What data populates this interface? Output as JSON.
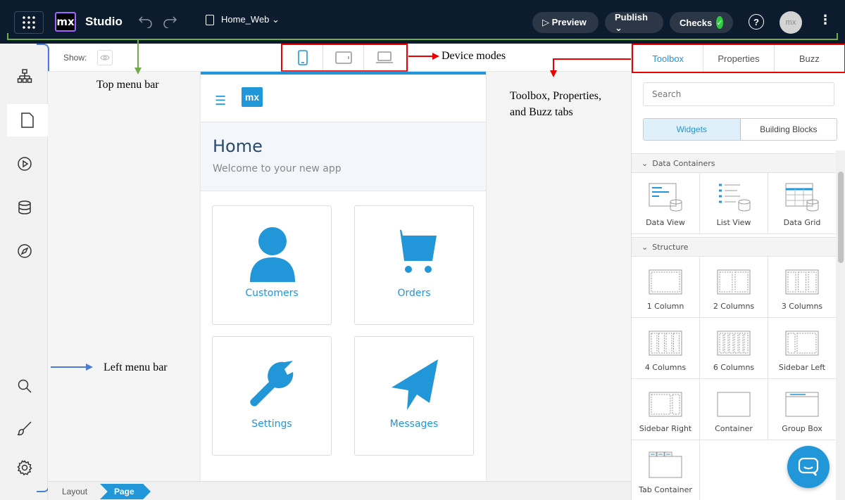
{
  "topbar": {
    "studio_title": "Studio",
    "logo_text": "mx",
    "page_name": "Home_Web ⌄",
    "preview_label": "▷ Preview",
    "publish_label": "Publish ⌄",
    "checks_label": "Checks",
    "help_label": "?",
    "avatar_initials": "mx",
    "more_label": "⋮"
  },
  "leftbar": {
    "items": [
      "sitemap-icon",
      "page-icon",
      "microflow-icon",
      "domain-model-icon",
      "navigation-icon",
      "search-icon",
      "theme-brush-icon",
      "settings-icon"
    ],
    "active": "page-icon"
  },
  "canvas": {
    "show_label": "Show:",
    "device_modes": [
      "phone",
      "tablet",
      "desktop"
    ],
    "active_device": "phone"
  },
  "app": {
    "logo_text": "mx",
    "home_title": "Home",
    "home_subtitle": "Welcome to your new app",
    "tiles": [
      {
        "label": "Customers",
        "icon": "user-icon"
      },
      {
        "label": "Orders",
        "icon": "cart-icon"
      },
      {
        "label": "Settings",
        "icon": "wrench-icon"
      },
      {
        "label": "Messages",
        "icon": "paper-plane-icon"
      }
    ],
    "accent": "#2196d8"
  },
  "breadcrumb": {
    "layout": "Layout",
    "page": "Page"
  },
  "rightpanel": {
    "tabs": [
      "Toolbox",
      "Properties",
      "Buzz"
    ],
    "active_tab": "Toolbox",
    "search_placeholder": "Search",
    "segments": [
      "Widgets",
      "Building Blocks"
    ],
    "sections": [
      {
        "title": "Data Containers",
        "widgets": [
          "Data View",
          "List View",
          "Data Grid"
        ]
      },
      {
        "title": "Structure",
        "widgets": [
          "1 Column",
          "2 Columns",
          "3 Columns",
          "4 Columns",
          "6 Columns",
          "Sidebar Left",
          "Sidebar Right",
          "Container",
          "Group Box",
          "Tab Container"
        ]
      }
    ]
  },
  "annotations": {
    "top_menu": "Top menu bar",
    "left_menu": "Left menu bar",
    "device_modes": "Device modes",
    "tabs_line1": "Toolbox, Properties,",
    "tabs_line2": "and Buzz tabs"
  },
  "colors": {
    "topbar_bg": "#0d1b2e",
    "annotation_red": "#e00000",
    "annotation_green": "#70ad47",
    "annotation_blue": "#4a7cd6"
  }
}
